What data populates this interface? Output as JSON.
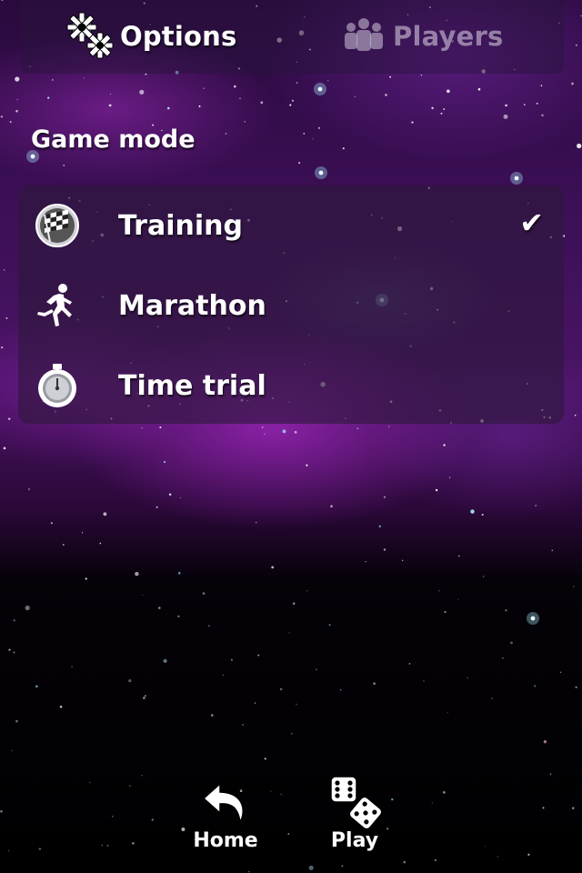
{
  "tabs": {
    "options": {
      "label": "Options",
      "icon": "gears-icon",
      "active": true
    },
    "players": {
      "label": "Players",
      "icon": "people-icon",
      "active": false
    }
  },
  "game_mode": {
    "title": "Game mode",
    "items": [
      {
        "label": "Training",
        "icon": "checkered-flag-icon",
        "selected": true
      },
      {
        "label": "Marathon",
        "icon": "runner-icon",
        "selected": false
      },
      {
        "label": "Time trial",
        "icon": "stopwatch-icon",
        "selected": false
      }
    ],
    "check_glyph": "✔"
  },
  "bottom_bar": {
    "home_label": "Home",
    "play_label": "Play"
  },
  "colors": {
    "text": "#ffffff",
    "inactive_text": "#d2c8dc",
    "panel": "#2d193c"
  }
}
